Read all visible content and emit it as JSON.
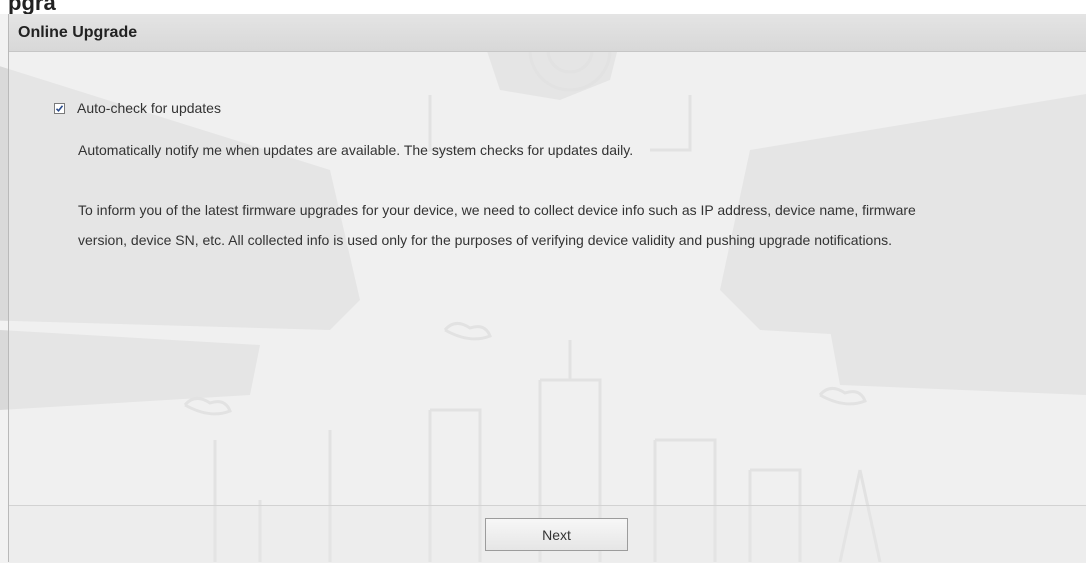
{
  "window": {
    "top_title_fragment": "pgra"
  },
  "panel": {
    "title": "Online Upgrade"
  },
  "auto_check": {
    "checked": true,
    "label": "Auto-check for updates"
  },
  "descriptions": {
    "line1": "Automatically notify me when updates are available. The system checks for updates daily.",
    "line2": "To inform you of the latest firmware upgrades for your device, we need to collect device info such as IP address, device name, firmware",
    "line3": "version, device SN, etc. All collected info is used only for the purposes of verifying device validity and pushing upgrade notifications."
  },
  "footer": {
    "next_label": "Next"
  },
  "colors": {
    "background": "#f2f2f2",
    "header": "#dddddd",
    "art": "#dcdcdc"
  },
  "icons": {
    "checkbox": "checkmark-icon"
  }
}
